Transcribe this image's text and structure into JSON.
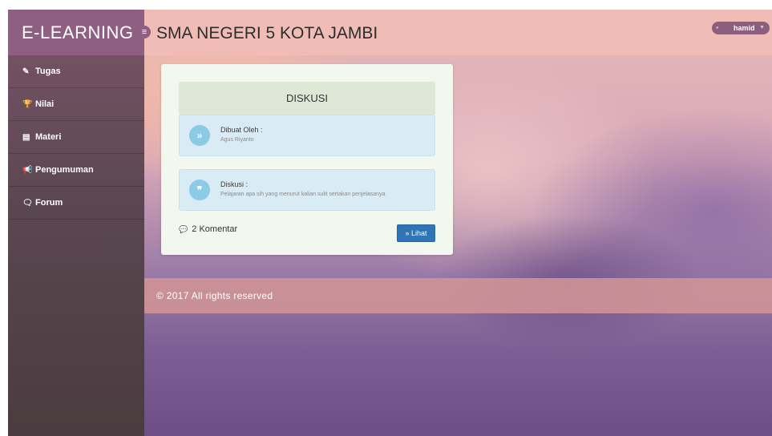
{
  "brand": {
    "title": "E-LEARNING"
  },
  "header": {
    "school_name": "SMA NEGERI 5 KOTA JAMBI",
    "toggle_glyph": "≡"
  },
  "user_menu": {
    "username": "hamid",
    "caret": "▼"
  },
  "sidebar": {
    "items": [
      {
        "label": "Tugas",
        "icon": "pencil-icon",
        "glyph": "✎"
      },
      {
        "label": "Nilai",
        "icon": "trophy-icon",
        "glyph": "🏆"
      },
      {
        "label": "Materi",
        "icon": "book-icon",
        "glyph": "▤"
      },
      {
        "label": "Pengumuman",
        "icon": "megaphone-icon",
        "glyph": "📢"
      },
      {
        "label": "Forum",
        "icon": "comments-icon",
        "glyph": "🗨"
      }
    ]
  },
  "discussion": {
    "heading": "DISKUSI",
    "author_label": "Dibuat Oleh :",
    "author_name": "Agus Riyanto",
    "author_icon_glyph": "»",
    "topic_label": "Diskusi :",
    "topic_text": "Pelajaran apa sih yang menurut kalian sulit sertakan penjelasanya",
    "topic_icon_glyph": "❞",
    "comments_count": "2 Komentar",
    "comment_icon_glyph": "💬",
    "view_button": "» Lihat"
  },
  "footer": {
    "text": "© 2017 All rights reserved"
  },
  "colors": {
    "brand_bg": "#8f5f82",
    "header_bg": "#f0bcb6",
    "button_primary": "#2f74b5",
    "info_bg": "#d9ebf5",
    "card_head_bg": "#dde9d6"
  }
}
